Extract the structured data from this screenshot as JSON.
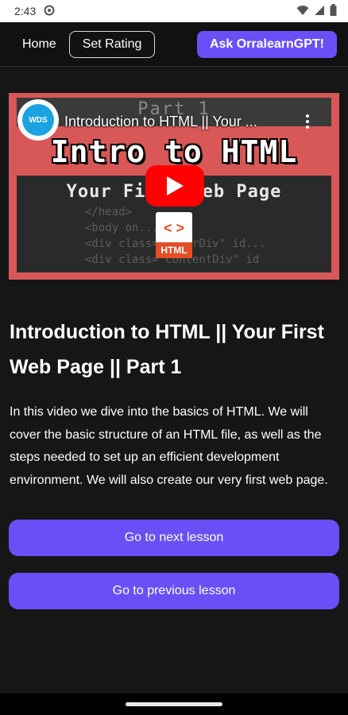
{
  "status_bar": {
    "time": "2:43",
    "icons": [
      "notification-circle-icon",
      "wifi-icon",
      "signal-icon",
      "battery-icon"
    ]
  },
  "header": {
    "home_label": "Home",
    "rating_label": "Set Rating",
    "gpt_label": "Ask OrralearnGPT!",
    "accent_color": "#6b4ff6"
  },
  "video": {
    "overlay_title": "Introduction to HTML || Your ...",
    "channel_logo_text": "WDS",
    "thumbnail_part_text": "Part 1",
    "thumbnail_title": "Intro to HTML",
    "thumbnail_subtitle": "Your First Web Page",
    "thumbnail_code": "</head>\n<body on...\n<div class=\"outerDiv\" id...\n<div class=\"contentDiv\" id",
    "file_tag": "HTML",
    "file_brackets": "< >",
    "play_icon": "play-icon"
  },
  "lesson": {
    "title": "Introduction to HTML || Your First Web Page || Part 1",
    "description": "In this video we dive into the basics of HTML. We will cover the basic structure of an HTML file, as well as the steps needed to set up an efficient development environment. We will also create our very first web page.",
    "next_label": "Go to next lesson",
    "prev_label": "Go to previous lesson"
  }
}
